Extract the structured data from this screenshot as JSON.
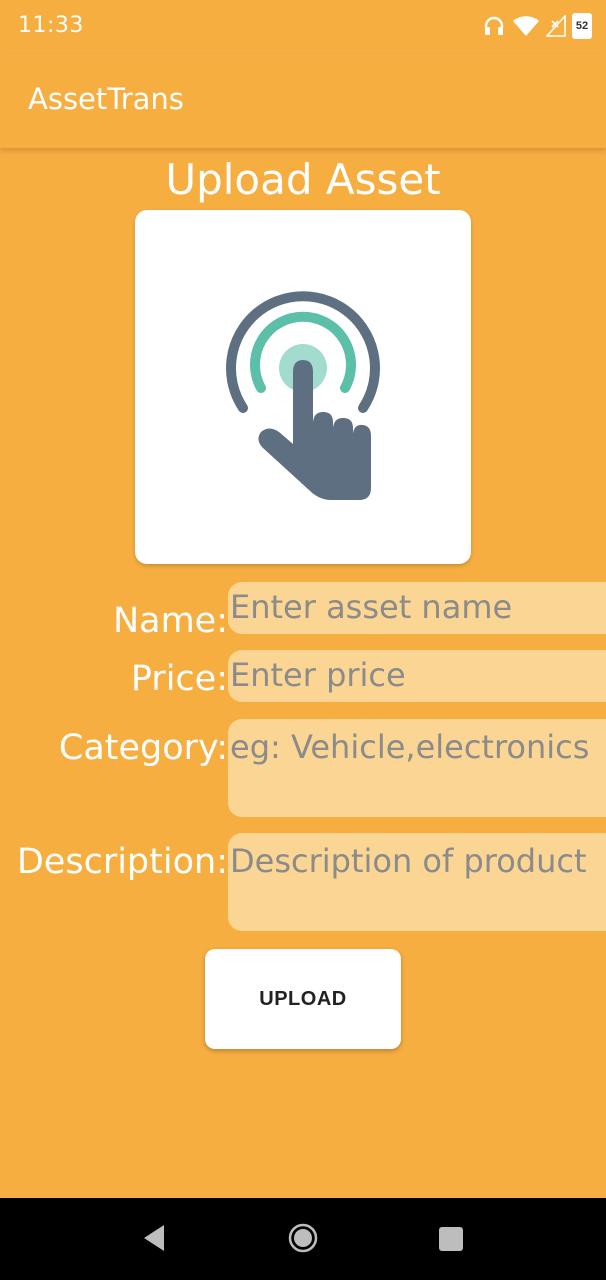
{
  "status_bar": {
    "time": "11:33",
    "battery_level": "52",
    "icons": [
      "headphones-icon",
      "wifi-icon",
      "signal-icon",
      "battery-icon"
    ]
  },
  "app_bar": {
    "title": "AssetTrans"
  },
  "page": {
    "title": "Upload Asset",
    "image_icon": "touch-hand-icon"
  },
  "form": {
    "name_label": "Name:",
    "name_placeholder": "Enter asset name",
    "price_label": "Price:",
    "price_placeholder": "Enter price",
    "category_label": "Category:",
    "category_placeholder": "eg: Vehicle,electronics",
    "description_label": "Description:",
    "description_placeholder": "Description of product"
  },
  "upload_button": {
    "label": "UPLOAD"
  },
  "nav_bar": {
    "icons": [
      "back-icon",
      "home-icon",
      "recents-icon"
    ]
  },
  "colors": {
    "background": "#F7AE41",
    "input_background": "#FBD593",
    "placeholder_text": "#8B8B8B",
    "icon_dark": "#5D6F80",
    "icon_teal": "#5BC0A7",
    "icon_teal_light": "#A3DBCE"
  }
}
